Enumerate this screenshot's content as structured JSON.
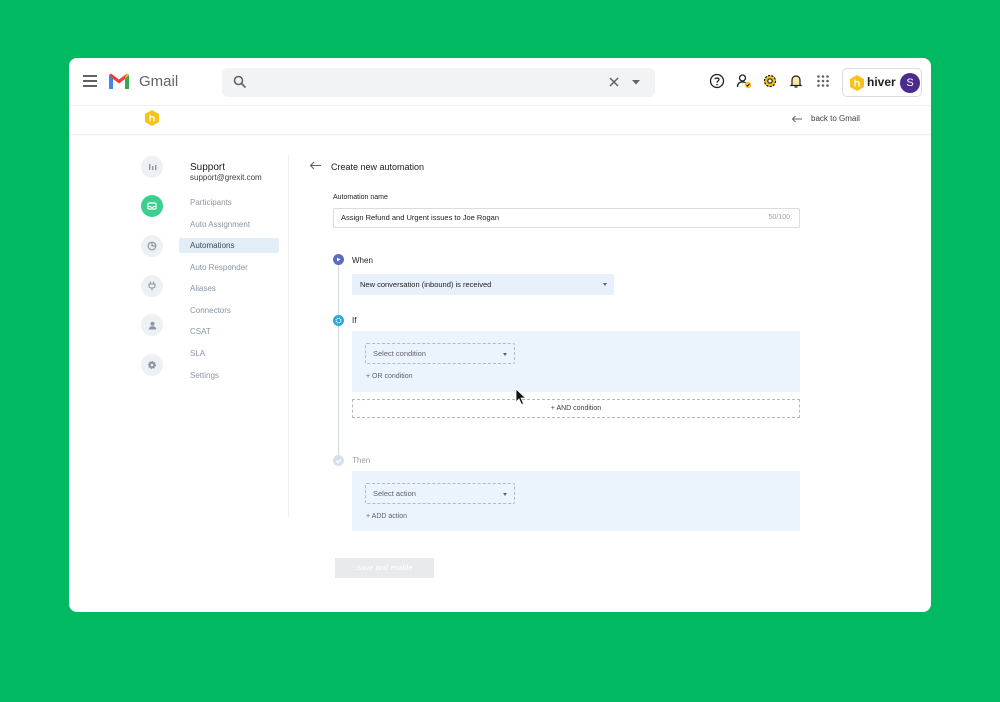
{
  "gmail": {
    "app_name": "Gmail",
    "search": {
      "value": "",
      "placeholder": ""
    },
    "hiver_label": "hiver",
    "avatar_initial": "S"
  },
  "subbar": {
    "back_link": "back to Gmail"
  },
  "sidebar": {
    "inbox_name": "Support",
    "inbox_email": "support@grexit.com",
    "items": [
      {
        "label": "Participants"
      },
      {
        "label": "Auto Assignment"
      },
      {
        "label": "Automations",
        "active": true
      },
      {
        "label": "Auto Responder"
      },
      {
        "label": "Aliases"
      },
      {
        "label": "Connectors"
      },
      {
        "label": "CSAT"
      },
      {
        "label": "SLA"
      },
      {
        "label": "Settings"
      }
    ]
  },
  "main": {
    "title": "Create new automation",
    "name_label": "Automation name",
    "name_value": "Assign Refund and Urgent issues to Joe Rogan",
    "name_count": "50/100",
    "when": {
      "label": "When",
      "selected": "New conversation (inbound) is received"
    },
    "if": {
      "label": "If",
      "condition_placeholder": "Select condition",
      "or_link": "+ OR condition",
      "and_button": "+ AND condition"
    },
    "then": {
      "label": "Then",
      "action_placeholder": "Select action",
      "add_link": "+ ADD action"
    },
    "save_button": "Save and enable"
  },
  "colors": {
    "background": "#00b960",
    "active_nav": "#e3edf6",
    "panel": "#ebf3fc",
    "when_dot": "#5c6bc0",
    "if_dot": "#29a8e0",
    "hiver_yellow": "#f7c21a"
  }
}
